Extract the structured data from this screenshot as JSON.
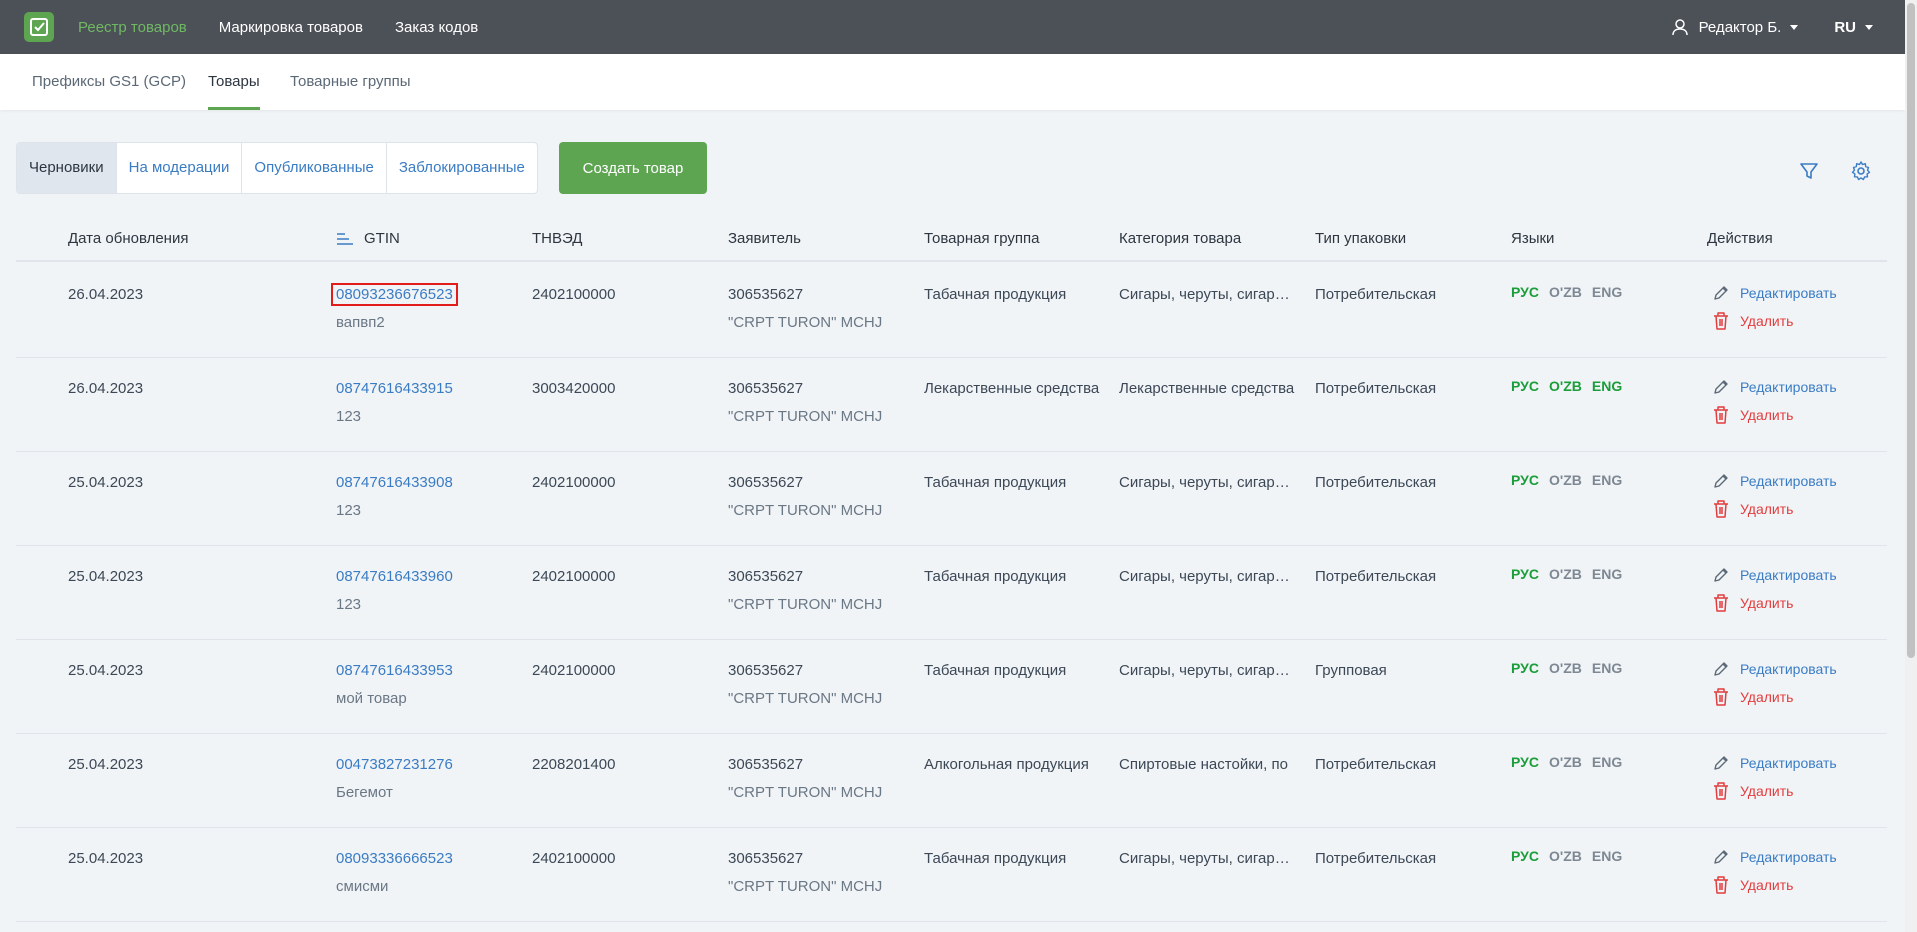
{
  "topbar": {
    "nav": [
      "Реестр товаров",
      "Маркировка товаров",
      "Заказ кодов"
    ],
    "user": "Редактор Б.",
    "lang": "RU"
  },
  "subtabs": [
    "Префиксы GS1 (GCP)",
    "Товары",
    "Товарные группы"
  ],
  "status_tabs": [
    "Черновики",
    "На модерации",
    "Опубликованные",
    "Заблокированные"
  ],
  "create_button": "Создать товар",
  "columns": [
    "Дата обновления",
    "GTIN",
    "ТНВЭД",
    "Заявитель",
    "Товарная группа",
    "Категория товара",
    "Тип упаковки",
    "Языки",
    "Действия"
  ],
  "actions": {
    "edit": "Редактировать",
    "delete": "Удалить"
  },
  "lang_labels": [
    "РУС",
    "O'ZB",
    "ENG"
  ],
  "rows": [
    {
      "date": "26.04.2023",
      "gtin": "08093236676523",
      "name": "вапвп2",
      "tnved": "2402100000",
      "applicant_id": "306535627",
      "applicant_name": "\"CRPT TURON\" MCHJ",
      "group": "Табачная продукция",
      "category": "Сигары, черуты, сигариллы",
      "package": "Потребительская"
    },
    {
      "date": "26.04.2023",
      "gtin": "08747616433915",
      "name": "123",
      "tnved": "3003420000",
      "applicant_id": "306535627",
      "applicant_name": "\"CRPT TURON\" MCHJ",
      "group": "Лекарственные средства",
      "category": "Лекарственные средства",
      "package": "Потребительская"
    },
    {
      "date": "25.04.2023",
      "gtin": "08747616433908",
      "name": "123",
      "tnved": "2402100000",
      "applicant_id": "306535627",
      "applicant_name": "\"CRPT TURON\" MCHJ",
      "group": "Табачная продукция",
      "category": "Сигары, черуты, сигариллы",
      "package": "Потребительская"
    },
    {
      "date": "25.04.2023",
      "gtin": "08747616433960",
      "name": "123",
      "tnved": "2402100000",
      "applicant_id": "306535627",
      "applicant_name": "\"CRPT TURON\" MCHJ",
      "group": "Табачная продукция",
      "category": "Сигары, черуты, сигариллы",
      "package": "Потребительская"
    },
    {
      "date": "25.04.2023",
      "gtin": "08747616433953",
      "name": "мой товар",
      "tnved": "2402100000",
      "applicant_id": "306535627",
      "applicant_name": "\"CRPT TURON\" MCHJ",
      "group": "Табачная продукция",
      "category": "Сигары, черуты, сигариллы",
      "package": "Групповая"
    },
    {
      "date": "25.04.2023",
      "gtin": "00473827231276",
      "name": "Бегемот",
      "tnved": "2208201400",
      "applicant_id": "306535627",
      "applicant_name": "\"CRPT TURON\" MCHJ",
      "group": "Алкогольная продукция",
      "category": "Спиртовые настойки, по",
      "package": "Потребительская"
    },
    {
      "date": "25.04.2023",
      "gtin": "08093336666523",
      "name": "смисми",
      "tnved": "2402100000",
      "applicant_id": "306535627",
      "applicant_name": "\"CRPT TURON\" MCHJ",
      "group": "Табачная продукция",
      "category": "Сигары, черуты, сигариллы",
      "package": "Потребительская"
    }
  ],
  "row_langs_active": [
    [
      true,
      false,
      false
    ],
    [
      true,
      true,
      true
    ],
    [
      true,
      false,
      false
    ],
    [
      true,
      false,
      false
    ],
    [
      true,
      false,
      false
    ],
    [
      true,
      false,
      false
    ],
    [
      true,
      false,
      false
    ]
  ],
  "colors": {
    "accent": "#5ea552",
    "link": "#3a7cc4",
    "danger": "#e23d3d",
    "topbar": "#4c5057",
    "lang_active": "#1b9e3a"
  }
}
